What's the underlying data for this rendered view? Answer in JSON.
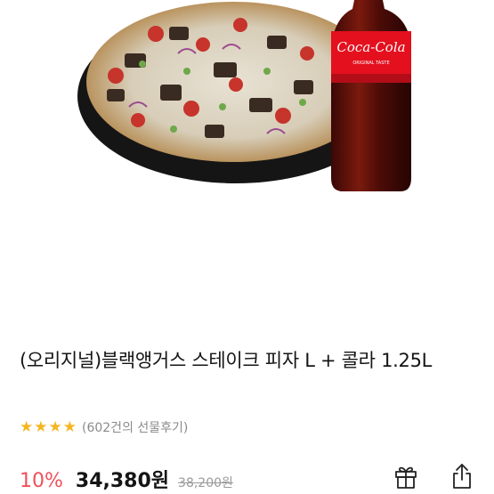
{
  "product": {
    "image_alt_icon": "pizza-and-cola-image",
    "cola_brand": "Coca-Cola",
    "cola_sub": "ORIGINAL TASTE",
    "title": "(오리지널)블랙앵거스 스테이크 피자 L + 콜라 1.25L",
    "rating": {
      "stars": 4,
      "review_text": "(602건의 선물후기)"
    },
    "price": {
      "discount": "10%",
      "sale": "34,380원",
      "original": "38,200원"
    }
  },
  "actions": {
    "gift_icon": "gift-icon",
    "share_icon": "share-icon"
  },
  "colors": {
    "star": "#f5b623",
    "discount": "#f0505a",
    "cola_red": "#e4101e"
  }
}
